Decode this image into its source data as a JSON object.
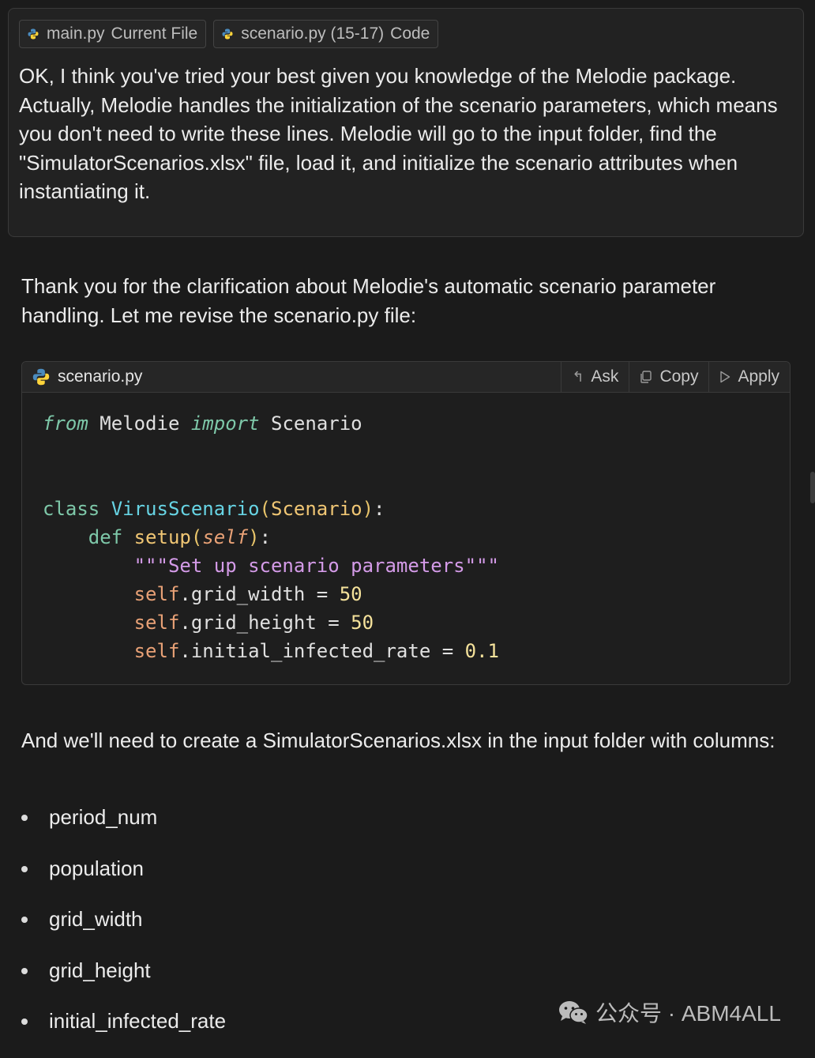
{
  "context_chips": [
    {
      "name": "main.py",
      "kind": "Current File"
    },
    {
      "name": "scenario.py (15-17)",
      "kind": "Code"
    }
  ],
  "user_message": "OK, I think you've tried your best given you knowledge of the Melodie package. Actually, Melodie handles the initialization of the scenario parameters, which means you don't need to write these lines. Melodie will go to the input folder, find the \"SimulatorScenarios.xlsx\" file, load it, and initialize the scenario attributes when instantiating it.",
  "assistant_intro": "Thank you for the clarification about Melodie's automatic scenario parameter handling. Let me revise the scenario.py file:",
  "code_block": {
    "filename": "scenario.py",
    "actions": {
      "ask": "Ask",
      "copy": "Copy",
      "apply": "Apply"
    },
    "tokens": {
      "from": "from",
      "module": "Melodie",
      "import": "import",
      "imported": "Scenario",
      "class_kw": "class",
      "class_name": "VirusScenario",
      "base": "Scenario",
      "def_kw": "def",
      "method": "setup",
      "self": "self",
      "docstring": "\"\"\"Set up scenario parameters\"\"\"",
      "attr1": "grid_width",
      "val1": "50",
      "attr2": "grid_height",
      "val2": "50",
      "attr3": "initial_infected_rate",
      "val3": "0.1"
    }
  },
  "columns_intro": "And we'll need to create a SimulatorScenarios.xlsx in the input folder with columns:",
  "columns": [
    "period_num",
    "population",
    "grid_width",
    "grid_height",
    "initial_infected_rate"
  ],
  "watermark": "公众号 · ABM4ALL"
}
